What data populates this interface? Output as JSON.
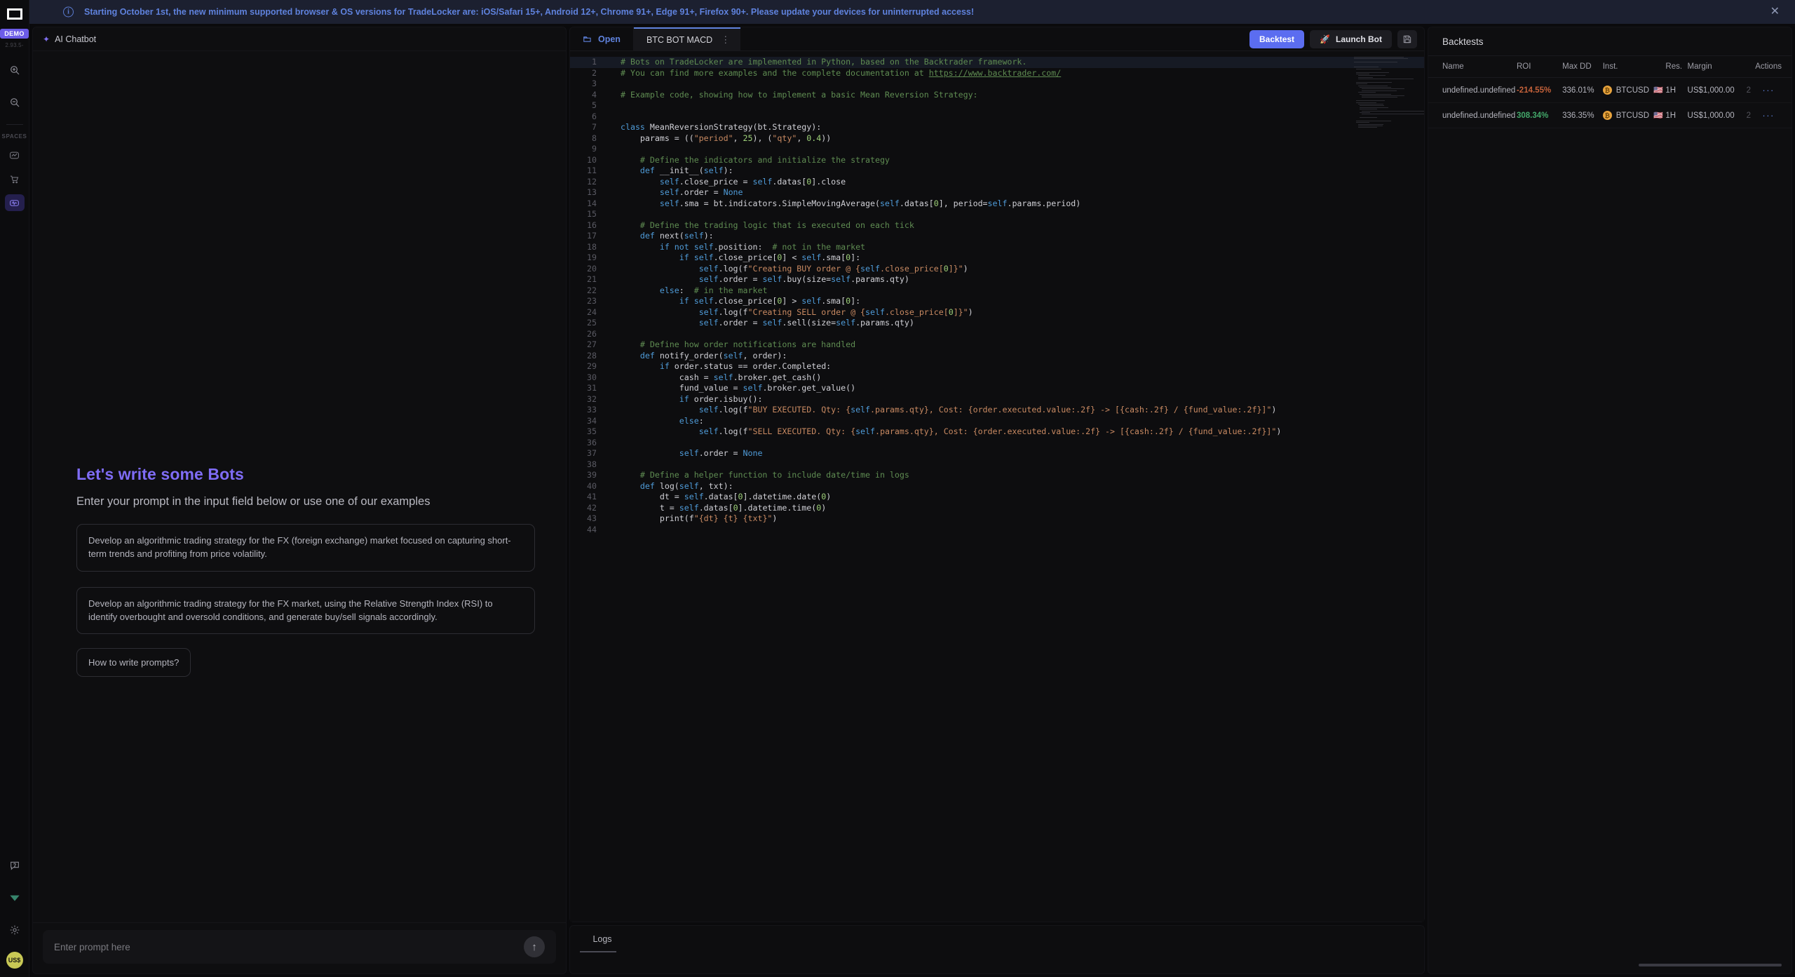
{
  "banner": {
    "icon": "info-icon",
    "text": "Starting October 1st, the new minimum supported browser & OS versions for TradeLocker are: iOS/Safari 15+, Android 12+, Chrome 91+, Edge 91+, Firefox 90+. Please update your devices for uninterrupted access!",
    "close": "✕"
  },
  "rail": {
    "demo_badge": "DEMO",
    "version": "2.93.5-",
    "spaces_label": "SPACES",
    "icons": [
      {
        "name": "zoom-in-icon"
      },
      {
        "name": "zoom-out-icon"
      }
    ],
    "spaces": [
      {
        "name": "space-chart",
        "active": false
      },
      {
        "name": "space-cart",
        "active": false
      },
      {
        "name": "space-bots",
        "active": true
      }
    ],
    "bottom": [
      {
        "name": "help-icon"
      },
      {
        "name": "signal-icon"
      },
      {
        "name": "settings-icon"
      }
    ],
    "avatar": "US$"
  },
  "chat": {
    "title": "AI Chatbot",
    "heading": "Let's write some Bots",
    "subheading": "Enter your prompt in the input field below or use one of our examples",
    "examples": [
      "Develop an algorithmic trading strategy for the FX (foreign exchange) market focused on capturing short-term trends and profiting from price volatility.",
      "Develop an algorithmic trading strategy for the FX market, using the Relative Strength Index (RSI) to identify overbought and oversold conditions, and generate buy/sell signals accordingly."
    ],
    "how_to": "How to write prompts?",
    "input_placeholder": "Enter prompt here",
    "input_value": "",
    "send_icon": "↑"
  },
  "editor": {
    "open_tab": "Open",
    "file_tab": "BTC BOT MACD",
    "tab_menu": "⋮",
    "backtest_label": "Backtest",
    "launch_label": "Launch Bot",
    "save_icon": "save-icon",
    "logs_tab": "Logs",
    "code_lines": [
      {
        "n": 1,
        "html": "<span class=\"cm\"># Bots on TradeLocker are implemented in Python, based on the Backtrader framework.</span>",
        "hl": true
      },
      {
        "n": 2,
        "html": "<span class=\"cm\"># You can find more examples and the complete documentation at </span><span class=\"lnk\">https://www.backtrader.com/</span>"
      },
      {
        "n": 3,
        "html": ""
      },
      {
        "n": 4,
        "html": "<span class=\"cm\"># Example code, showing how to implement a basic Mean Reversion Strategy:</span>"
      },
      {
        "n": 5,
        "html": ""
      },
      {
        "n": 6,
        "html": ""
      },
      {
        "n": 7,
        "html": "<span class=\"kw\">class</span> <span class=\"pl\">MeanReversionStrategy(bt.Strategy):</span>"
      },
      {
        "n": 8,
        "html": "    <span class=\"pl\">params = ((</span><span class=\"st\">\"period\"</span><span class=\"pl\">, </span><span class=\"nm\">25</span><span class=\"pl\">), (</span><span class=\"st\">\"qty\"</span><span class=\"pl\">, </span><span class=\"nm\">0.4</span><span class=\"pl\">))</span>"
      },
      {
        "n": 9,
        "html": ""
      },
      {
        "n": 10,
        "html": "    <span class=\"cm\"># Define the indicators and initialize the strategy</span>"
      },
      {
        "n": 11,
        "html": "    <span class=\"kw\">def</span> <span class=\"pl\">__init__(</span><span class=\"sf\">self</span><span class=\"pl\">):</span>"
      },
      {
        "n": 12,
        "html": "        <span class=\"sf\">self</span><span class=\"pl\">.close_price = </span><span class=\"sf\">self</span><span class=\"pl\">.datas[</span><span class=\"nm\">0</span><span class=\"pl\">].close</span>"
      },
      {
        "n": 13,
        "html": "        <span class=\"sf\">self</span><span class=\"pl\">.order = </span><span class=\"kw\">None</span>"
      },
      {
        "n": 14,
        "html": "        <span class=\"sf\">self</span><span class=\"pl\">.sma = bt.indicators.SimpleMovingAverage(</span><span class=\"sf\">self</span><span class=\"pl\">.datas[</span><span class=\"nm\">0</span><span class=\"pl\">], period=</span><span class=\"sf\">self</span><span class=\"pl\">.params.period)</span>"
      },
      {
        "n": 15,
        "html": ""
      },
      {
        "n": 16,
        "html": "    <span class=\"cm\"># Define the trading logic that is executed on each tick</span>"
      },
      {
        "n": 17,
        "html": "    <span class=\"kw\">def</span> <span class=\"pl\">next(</span><span class=\"sf\">self</span><span class=\"pl\">):</span>"
      },
      {
        "n": 18,
        "html": "        <span class=\"kw\">if not</span> <span class=\"sf\">self</span><span class=\"pl\">.position:  </span><span class=\"cm\"># not in the market</span>"
      },
      {
        "n": 19,
        "html": "            <span class=\"kw\">if</span> <span class=\"sf\">self</span><span class=\"pl\">.close_price[</span><span class=\"nm\">0</span><span class=\"pl\">] &lt; </span><span class=\"sf\">self</span><span class=\"pl\">.sma[</span><span class=\"nm\">0</span><span class=\"pl\">]:</span>"
      },
      {
        "n": 20,
        "html": "                <span class=\"sf\">self</span><span class=\"pl\">.log(f</span><span class=\"st\">\"Creating BUY order @ {</span><span class=\"sf\">self</span><span class=\"st\">.close_price[</span><span class=\"nm\">0</span><span class=\"st\">]}\"</span><span class=\"pl\">)</span>"
      },
      {
        "n": 21,
        "html": "                <span class=\"sf\">self</span><span class=\"pl\">.order = </span><span class=\"sf\">self</span><span class=\"pl\">.buy(size=</span><span class=\"sf\">self</span><span class=\"pl\">.params.qty)</span>"
      },
      {
        "n": 22,
        "html": "        <span class=\"kw\">else</span><span class=\"pl\">:  </span><span class=\"cm\"># in the market</span>"
      },
      {
        "n": 23,
        "html": "            <span class=\"kw\">if</span> <span class=\"sf\">self</span><span class=\"pl\">.close_price[</span><span class=\"nm\">0</span><span class=\"pl\">] &gt; </span><span class=\"sf\">self</span><span class=\"pl\">.sma[</span><span class=\"nm\">0</span><span class=\"pl\">]:</span>"
      },
      {
        "n": 24,
        "html": "                <span class=\"sf\">self</span><span class=\"pl\">.log(f</span><span class=\"st\">\"Creating SELL order @ {</span><span class=\"sf\">self</span><span class=\"st\">.close_price[</span><span class=\"nm\">0</span><span class=\"st\">]}\"</span><span class=\"pl\">)</span>"
      },
      {
        "n": 25,
        "html": "                <span class=\"sf\">self</span><span class=\"pl\">.order = </span><span class=\"sf\">self</span><span class=\"pl\">.sell(size=</span><span class=\"sf\">self</span><span class=\"pl\">.params.qty)</span>"
      },
      {
        "n": 26,
        "html": ""
      },
      {
        "n": 27,
        "html": "    <span class=\"cm\"># Define how order notifications are handled</span>"
      },
      {
        "n": 28,
        "html": "    <span class=\"kw\">def</span> <span class=\"pl\">notify_order(</span><span class=\"sf\">self</span><span class=\"pl\">, order):</span>"
      },
      {
        "n": 29,
        "html": "        <span class=\"kw\">if</span> <span class=\"pl\">order.status == order.Completed:</span>"
      },
      {
        "n": 30,
        "html": "            <span class=\"pl\">cash = </span><span class=\"sf\">self</span><span class=\"pl\">.broker.get_cash()</span>"
      },
      {
        "n": 31,
        "html": "            <span class=\"pl\">fund_value = </span><span class=\"sf\">self</span><span class=\"pl\">.broker.get_value()</span>"
      },
      {
        "n": 32,
        "html": "            <span class=\"kw\">if</span> <span class=\"pl\">order.isbuy():</span>"
      },
      {
        "n": 33,
        "html": "                <span class=\"sf\">self</span><span class=\"pl\">.log(f</span><span class=\"st\">\"BUY EXECUTED. Qty: {</span><span class=\"sf\">self</span><span class=\"st\">.params.qty}, Cost: {order.executed.value:.2f} -&gt; [{cash:.2f} / {fund_value:.2f}]\"</span><span class=\"pl\">)</span>"
      },
      {
        "n": 34,
        "html": "            <span class=\"kw\">else</span><span class=\"pl\">:</span>"
      },
      {
        "n": 35,
        "html": "                <span class=\"sf\">self</span><span class=\"pl\">.log(f</span><span class=\"st\">\"SELL EXECUTED. Qty: {</span><span class=\"sf\">self</span><span class=\"st\">.params.qty}, Cost: {order.executed.value:.2f} -&gt; [{cash:.2f} / {fund_value:.2f}]\"</span><span class=\"pl\">)</span>"
      },
      {
        "n": 36,
        "html": ""
      },
      {
        "n": 37,
        "html": "            <span class=\"sf\">self</span><span class=\"pl\">.order = </span><span class=\"kw\">None</span>"
      },
      {
        "n": 38,
        "html": ""
      },
      {
        "n": 39,
        "html": "    <span class=\"cm\"># Define a helper function to include date/time in logs</span>"
      },
      {
        "n": 40,
        "html": "    <span class=\"kw\">def</span> <span class=\"pl\">log(</span><span class=\"sf\">self</span><span class=\"pl\">, txt):</span>"
      },
      {
        "n": 41,
        "html": "        <span class=\"pl\">dt = </span><span class=\"sf\">self</span><span class=\"pl\">.datas[</span><span class=\"nm\">0</span><span class=\"pl\">].datetime.date(</span><span class=\"nm\">0</span><span class=\"pl\">)</span>"
      },
      {
        "n": 42,
        "html": "        <span class=\"pl\">t = </span><span class=\"sf\">self</span><span class=\"pl\">.datas[</span><span class=\"nm\">0</span><span class=\"pl\">].datetime.time(</span><span class=\"nm\">0</span><span class=\"pl\">)</span>"
      },
      {
        "n": 43,
        "html": "        <span class=\"pl\">print(f</span><span class=\"st\">\"{dt} {t} {txt}\"</span><span class=\"pl\">)</span>"
      },
      {
        "n": 44,
        "html": ""
      }
    ]
  },
  "backtests": {
    "title": "Backtests",
    "columns": [
      "Name",
      "ROI",
      "Max DD",
      "Inst.",
      "Res.",
      "Margin",
      "",
      "Actions"
    ],
    "rows": [
      {
        "name": "undefined.undefined",
        "roi": "-214.55%",
        "roi_sign": "neg",
        "max_dd": "336.01%",
        "instrument": "BTCUSD",
        "coin": "₿",
        "flag": "🇺🇸",
        "res": "1H",
        "margin": "US$1,000.00",
        "extra": "2",
        "actions": "···"
      },
      {
        "name": "undefined.undefined",
        "roi": "308.34%",
        "roi_sign": "pos",
        "max_dd": "336.35%",
        "instrument": "BTCUSD",
        "coin": "₿",
        "flag": "🇺🇸",
        "res": "1H",
        "margin": "US$1,000.00",
        "extra": "2",
        "actions": "···"
      }
    ]
  },
  "colors": {
    "accent_blue": "#5b6df0",
    "link_blue": "#5f82dd",
    "purple": "#7f6cf5",
    "positive": "#43a86a",
    "negative": "#c4613a",
    "banner_bg": "#1c2030"
  }
}
